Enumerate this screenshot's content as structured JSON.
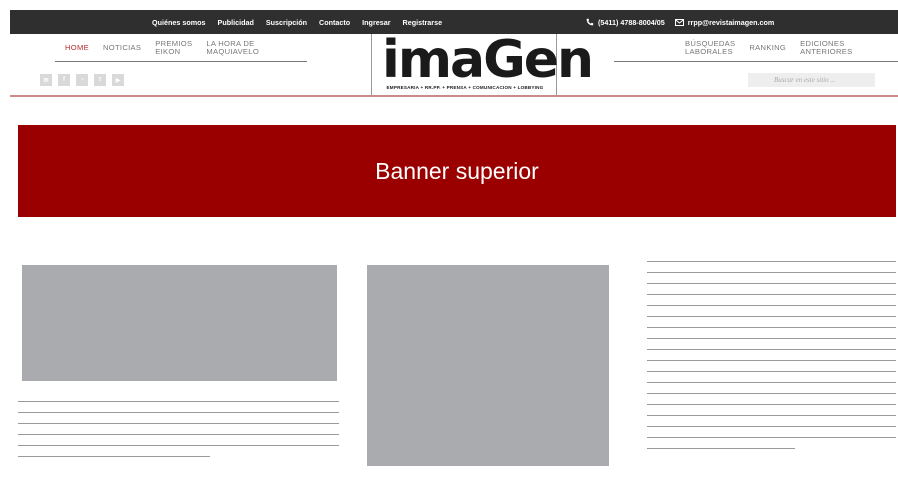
{
  "topbar": {
    "links": [
      "Quiénes somos",
      "Publicidad",
      "Suscripción",
      "Contacto",
      "Ingresar",
      "Registrarse"
    ],
    "phone": "(5411) 4788-8004/05",
    "email": "rrpp@revistaimagen.com"
  },
  "nav_left": [
    {
      "label": "HOME",
      "active": true
    },
    {
      "label": "NOTICIAS",
      "active": false
    },
    {
      "label": "PREMIOS\nEIKON",
      "active": false
    },
    {
      "label": "LA HORA DE\nMAQUIAVELO",
      "active": false
    }
  ],
  "nav_right": [
    {
      "label": "BÚSQUEDAS\nLABORALES"
    },
    {
      "label": "RANKING"
    },
    {
      "label": "EDICIONES\nANTERIORES"
    }
  ],
  "social_icons": [
    "email-icon",
    "facebook-icon",
    "rss-icon",
    "twitter-icon",
    "youtube-icon"
  ],
  "logo": {
    "word": "imaGen",
    "tagline": "EMPRESARIA + RR.PP. + PRENSA + COMUNICACION + LOBBYING"
  },
  "search": {
    "placeholder": "Buscar en este sitio ..."
  },
  "banner": {
    "label": "Banner superior"
  },
  "colors": {
    "topbar": "#2f2f2f",
    "accent": "#b82e2e",
    "banner": "#9a0000",
    "placeholder": "#aaabae"
  }
}
